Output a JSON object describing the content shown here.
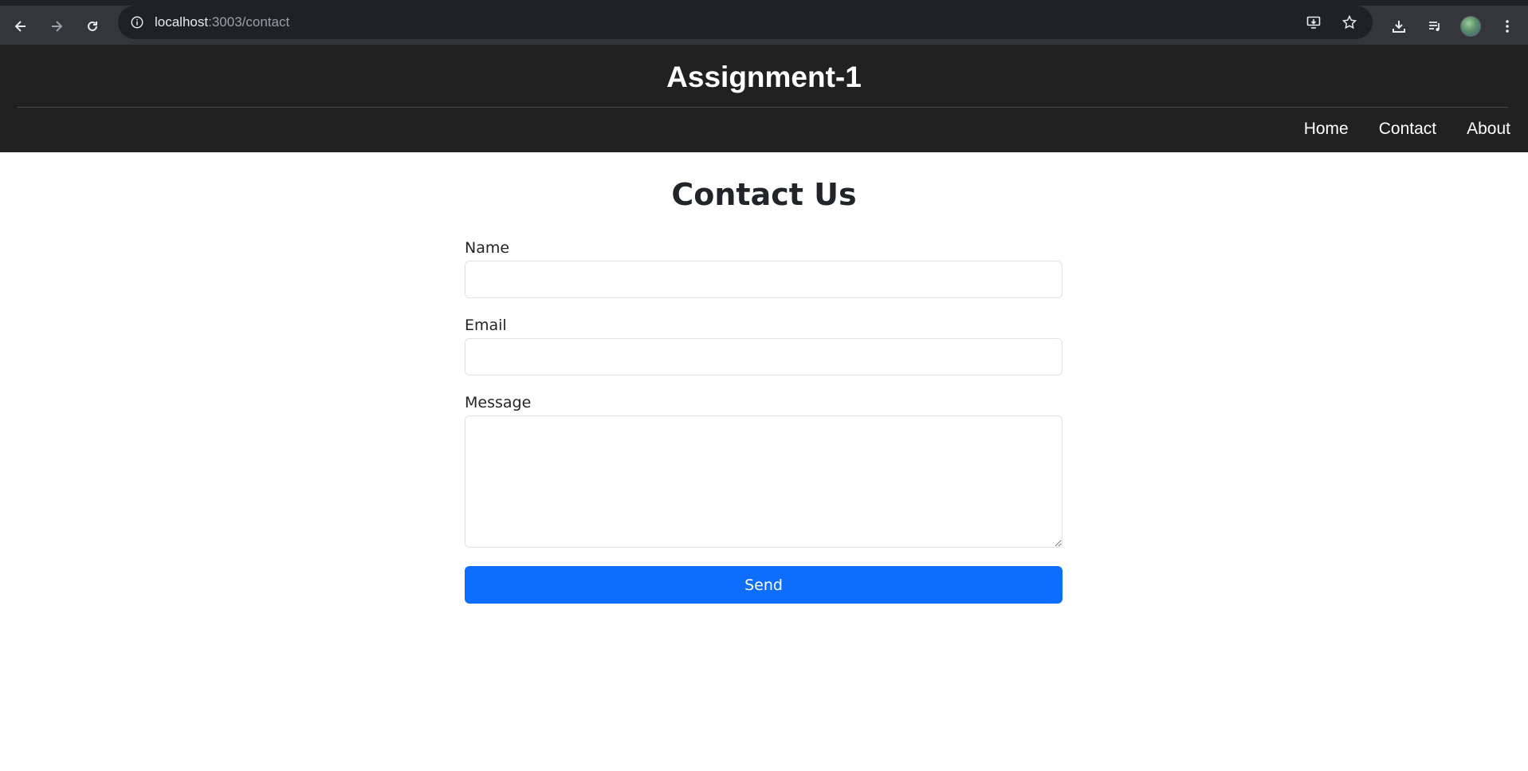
{
  "browser": {
    "url_host": "localhost",
    "url_rest": ":3003/contact"
  },
  "header": {
    "title": "Assignment-1",
    "nav": [
      "Home",
      "Contact",
      "About"
    ]
  },
  "main": {
    "title": "Contact Us",
    "fields": {
      "name_label": "Name",
      "name_value": "",
      "email_label": "Email",
      "email_value": "",
      "message_label": "Message",
      "message_value": ""
    },
    "send_label": "Send"
  },
  "colors": {
    "header_bg": "#212121",
    "button": "#0d6efd",
    "chrome_bg": "#35363a"
  }
}
